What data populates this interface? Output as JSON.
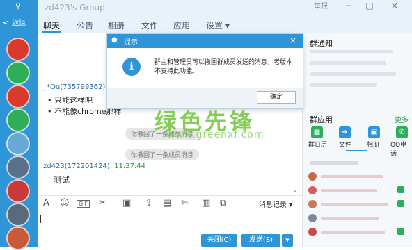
{
  "sidebar": {
    "back_label": "< 返回",
    "avatar_colors": [
      "#d83b2b",
      "#2fae5a",
      "#d83b2b",
      "#2fae5a",
      "#6aa8d8",
      "#5a6f8a",
      "#c83a3a",
      "#5a6a7a",
      "#c85a3a"
    ]
  },
  "window": {
    "title": "zd423's Group",
    "report": "举报",
    "controls": [
      "−",
      "□",
      "×"
    ]
  },
  "tabs": [
    {
      "label": "聊天",
      "active": true
    },
    {
      "label": "公告"
    },
    {
      "label": "相册"
    },
    {
      "label": "文件"
    },
    {
      "label": "应用"
    },
    {
      "label": "设置 ▾"
    }
  ],
  "chat": {
    "message1": {
      "sender": "_*Ou(",
      "sender_id": "735799362",
      "lines": [
        "只能这样吧",
        "不能像chrome那样"
      ]
    },
    "system_notices": [
      "你撤回了一条成员消息",
      "你撤回了一条成员消息"
    ],
    "message2": {
      "sender": "zd423(",
      "sender_id": "172201424",
      "time": "11:37:44",
      "text": "测试"
    }
  },
  "toolbar": {
    "icons": [
      "font-icon",
      "emoji-icon",
      "gif-icon",
      "screenshot-icon",
      "image-icon",
      "upload-icon",
      "gift-icon",
      "scissors-icon",
      "calendar-icon",
      "more-icon"
    ],
    "history_label": "消息记录 ▾"
  },
  "input": {
    "close_label": "关闭(C)",
    "send_label": "发送(S)",
    "send_arrow": "▼"
  },
  "right_panel": {
    "notice_title": "群通知",
    "apps_title": "群应用",
    "apps_more": "更多",
    "apps": [
      {
        "label": "群日历",
        "color": "#2fae5a",
        "glyph": "▦"
      },
      {
        "label": "文件",
        "color": "#2d95d8",
        "glyph": "➜"
      },
      {
        "label": "相册",
        "color": "#2d95d8",
        "glyph": "▣"
      },
      {
        "label": "QQ电话",
        "color": "#2fae5a",
        "glyph": "✆"
      }
    ]
  },
  "dialog": {
    "title": "提示",
    "message": "群主和管理员可以撤回群成员发送的消息，老版本不支持此功能。",
    "ok_label": "确定"
  },
  "watermark": {
    "text": "绿色先锋",
    "url": "www.greenxf.com"
  },
  "colors": {
    "accent": "#2d95d8",
    "sender_link": "#2d6da8",
    "time_green": "#2a9a3a"
  }
}
